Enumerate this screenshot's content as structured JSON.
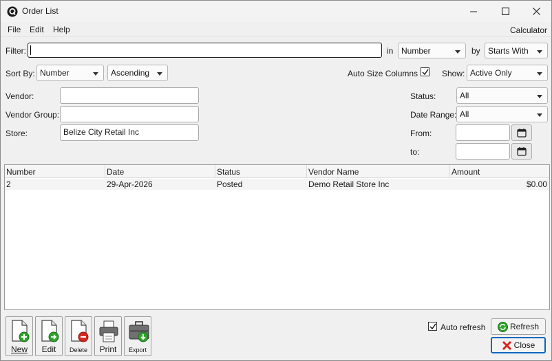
{
  "window": {
    "title": "Order List"
  },
  "menu": {
    "file": "File",
    "edit": "Edit",
    "help": "Help",
    "calculator": "Calculator"
  },
  "filter": {
    "label": "Filter:",
    "value": "",
    "in_label": "in",
    "in_value": "Number",
    "by_label": "by",
    "by_value": "Starts With"
  },
  "sort": {
    "label": "Sort By:",
    "field": "Number",
    "direction": "Ascending",
    "auto_size_label": "Auto Size Columns",
    "auto_size_checked": true,
    "show_label": "Show:",
    "show_value": "Active Only"
  },
  "criteria": {
    "vendor_label": "Vendor:",
    "vendor_value": "",
    "vendor_group_label": "Vendor Group:",
    "vendor_group_value": "",
    "store_label": "Store:",
    "store_value": "Belize City Retail Inc",
    "status_label": "Status:",
    "status_value": "All",
    "date_range_label": "Date Range:",
    "date_range_value": "All",
    "from_label": "From:",
    "from_value": "",
    "to_label": "to:",
    "to_value": ""
  },
  "grid": {
    "columns": [
      "Number",
      "Date",
      "Status",
      "Vendor Name",
      "Amount"
    ],
    "rows": [
      {
        "number": "2",
        "date": "29-Apr-2026",
        "status": "Posted",
        "vendor": "Demo Retail Store Inc",
        "amount": "$0.00"
      }
    ]
  },
  "toolbar": {
    "new": "New",
    "edit": "Edit",
    "delete": "Delete",
    "print": "Print",
    "export": "Export"
  },
  "footer": {
    "auto_refresh_label": "Auto refresh",
    "auto_refresh_checked": true,
    "refresh": "Refresh",
    "close": "Close"
  },
  "colors": {
    "accent": "#0067c0",
    "green": "#2fa52a",
    "red": "#d7261e"
  }
}
